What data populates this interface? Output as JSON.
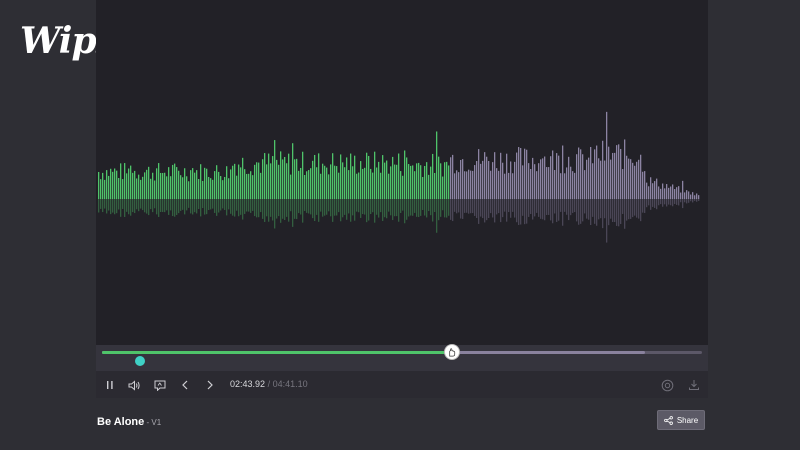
{
  "brand": {
    "logo_text": "Wipster"
  },
  "player": {
    "progress_fraction": 0.583,
    "buffered_fraction": 0.905,
    "comment_marker_fraction": 0.055,
    "played_color": "#4fc46a",
    "unplayed_color": "#8c84a3",
    "marker_color": "#3fd1c6",
    "current_time": "02:43.92",
    "duration": "/ 04:41.10"
  },
  "controls": {
    "play_pause_icon": "pause-icon",
    "volume_icon": "volume-icon",
    "comment_icon": "comment-icon",
    "prev_icon": "chevron-left-icon",
    "next_icon": "chevron-right-icon",
    "settings_icon": "settings-icon",
    "download_icon": "download-icon"
  },
  "track": {
    "title": "Be Alone",
    "version": " - V1"
  },
  "share": {
    "label": "Share"
  }
}
